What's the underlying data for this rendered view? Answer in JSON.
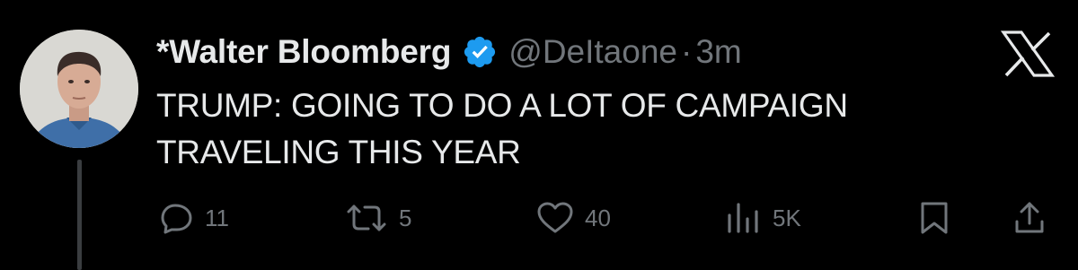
{
  "tweet": {
    "display_name": "*Walter Bloomberg",
    "handle": "@DeItaone",
    "separator": "·",
    "time": "3m",
    "text_line1": "TRUMP: GOING TO DO A LOT OF CAMPAIGN",
    "text_line2": "TRAVELING THIS YEAR",
    "verified": true
  },
  "actions": {
    "replies": "11",
    "reposts": "5",
    "likes": "40",
    "views": "5K"
  },
  "icons": {
    "verified": "verified-badge-icon",
    "brand": "x-logo-icon",
    "reply": "reply-icon",
    "repost": "repost-icon",
    "like": "heart-icon",
    "views": "views-icon",
    "bookmark": "bookmark-icon",
    "share": "share-icon"
  },
  "colors": {
    "background": "#000000",
    "text": "#e7e9ea",
    "muted": "#71767b",
    "verified": "#1d9bf0"
  }
}
